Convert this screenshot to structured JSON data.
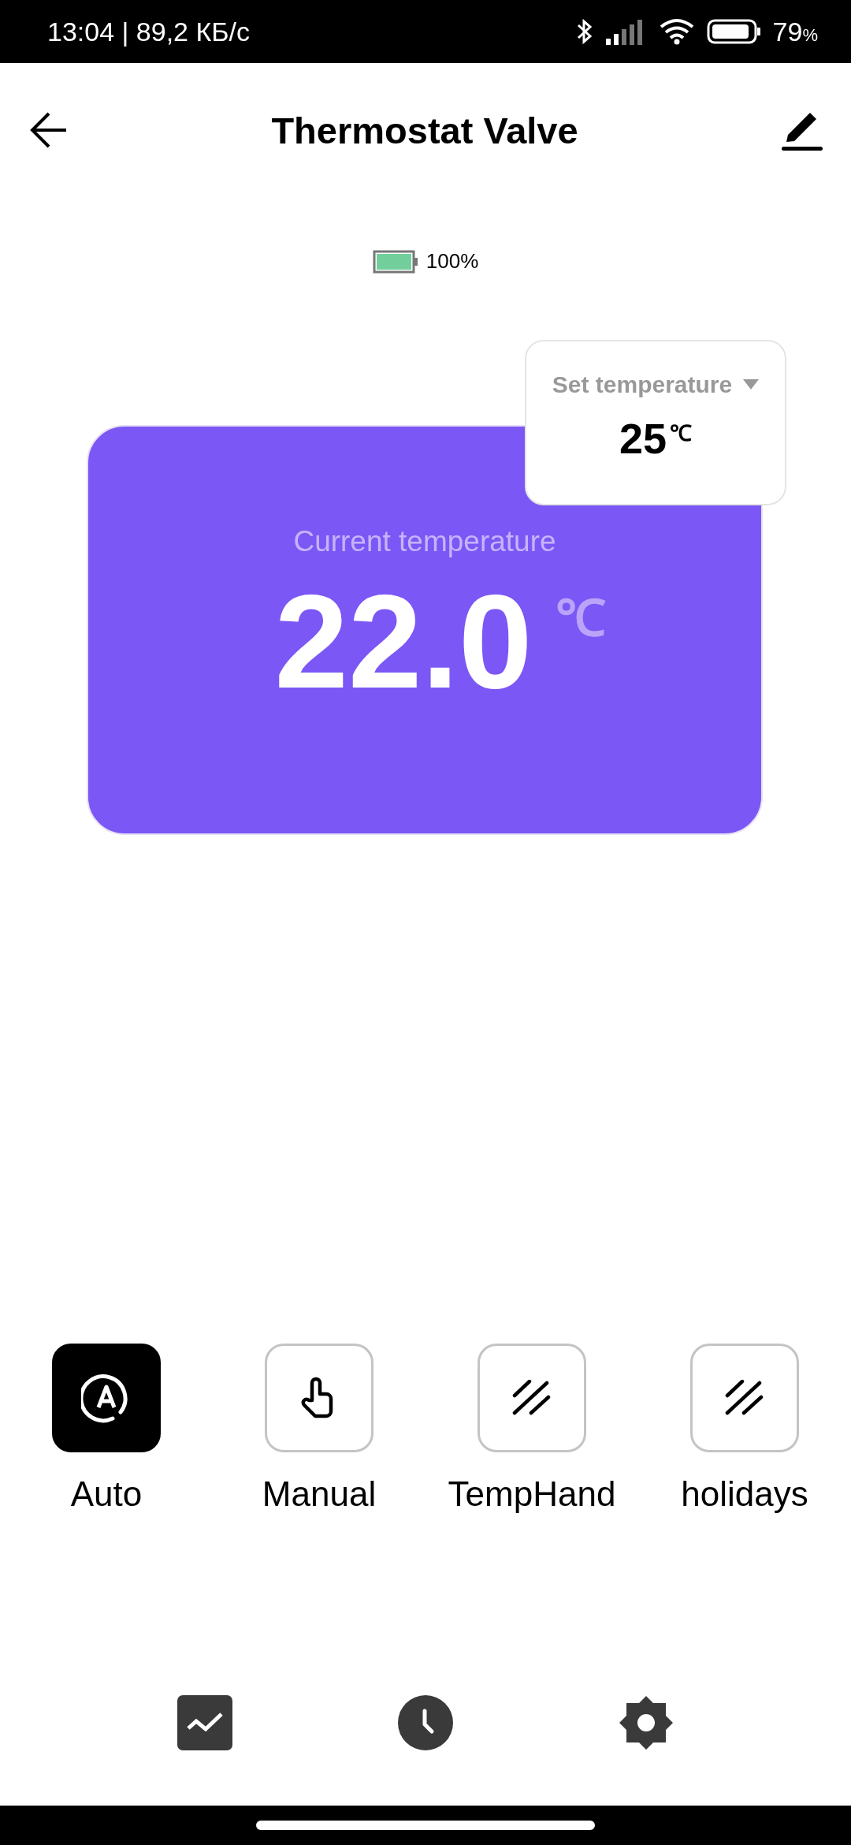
{
  "status_bar": {
    "time": "13:04 | 89,2 КБ/с",
    "battery": "79",
    "battery_unit": "%"
  },
  "header": {
    "title": "Thermostat Valve"
  },
  "device_battery": {
    "reading": "100%"
  },
  "set_temperature": {
    "label": "Set temperature",
    "value": "25",
    "unit": "℃"
  },
  "current_temperature": {
    "label": "Current temperature",
    "value": "22.0",
    "unit": "℃"
  },
  "modes": [
    {
      "label": "Auto",
      "kind": "auto",
      "selected": true
    },
    {
      "label": "Manual",
      "kind": "manual",
      "selected": false
    },
    {
      "label": "TempHand",
      "kind": "hatch",
      "selected": false
    },
    {
      "label": "holidays",
      "kind": "hatch",
      "selected": false
    }
  ]
}
